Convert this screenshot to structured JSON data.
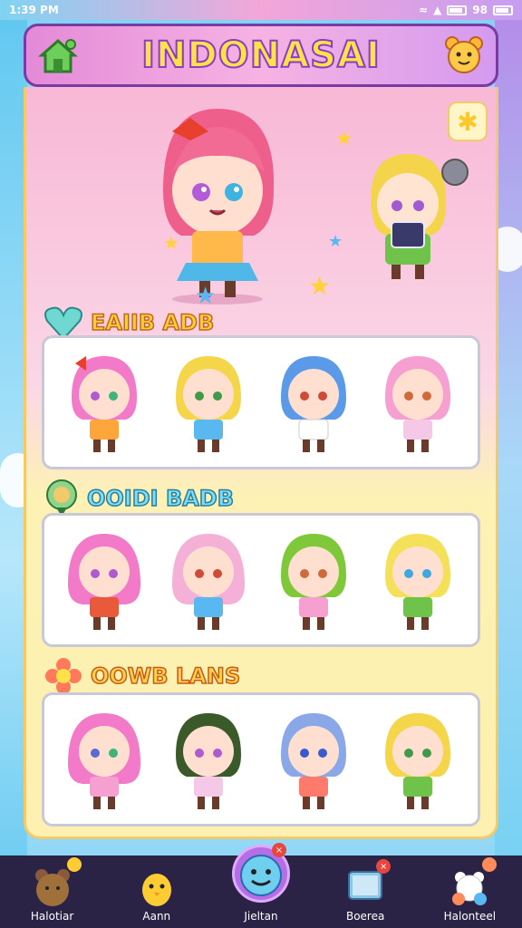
{
  "status": {
    "time": "1:39 PM",
    "right_text": "98"
  },
  "header": {
    "title": "INDONASAI"
  },
  "sections": [
    {
      "title": "EAIIB ADB"
    },
    {
      "title": "OOIDI BADB"
    },
    {
      "title": "OOWB LANS"
    }
  ],
  "nav": [
    {
      "label": "Halotiar"
    },
    {
      "label": "Aann"
    },
    {
      "label": "Jieltan"
    },
    {
      "label": "Boerea"
    },
    {
      "label": "Halonteel"
    }
  ],
  "colors": {
    "accent": "#ffe24a",
    "nav_bg": "#2a2346",
    "outline": "#8a3fbf"
  }
}
